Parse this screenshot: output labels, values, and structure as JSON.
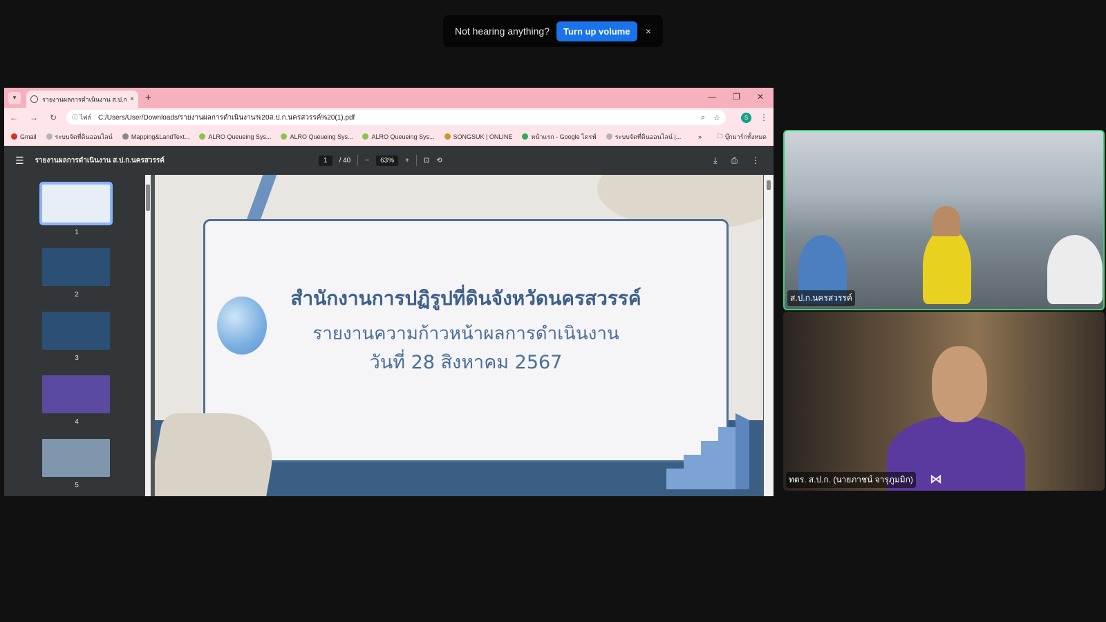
{
  "toast": {
    "message": "Not hearing anything?",
    "button": "Turn up volume",
    "close": "×"
  },
  "browser": {
    "tab_title": "รายงานผลการดำเนินงาน ส.ป.ก.นครสวรรค์",
    "tab_close": "×",
    "new_tab": "+",
    "site_info": "ไฟล์",
    "url": "C:/Users/User/Downloads/รายงานผลการดำเนินงาน%20ส.ป.ก.นครสวรรค์%20(1).pdf",
    "profile_letter": "S",
    "bookmarks": [
      {
        "label": "Gmail",
        "color": "#d93025"
      },
      {
        "label": "ระบบจัดที่ดินออนไลน์",
        "color": "#b5b5b5"
      },
      {
        "label": "Mapping&LandText...",
        "color": "#888888"
      },
      {
        "label": "ALRO Queueing Sys...",
        "color": "#8bc34a"
      },
      {
        "label": "ALRO Queueing Sys...",
        "color": "#8bc34a"
      },
      {
        "label": "ALRO Queueing Sys...",
        "color": "#8bc34a"
      },
      {
        "label": "SONGSUK | ONLINE",
        "color": "#c49a2c"
      },
      {
        "label": "หน้าแรก - Google ไดรฟ์",
        "color": "#34a853"
      },
      {
        "label": "ระบบจัดที่ดินออนไลน์ |...",
        "color": "#b5b5b5"
      }
    ],
    "bookmarks_more": "»",
    "bookmarks_folder": "บุ๊กมาร์กทั้งหมด"
  },
  "pdf": {
    "title": "รายงานผลการดำเนินงาน ส.ป.ก.นครสวรรค์",
    "page_current": "1",
    "page_total": "/ 40",
    "zoom": "63%",
    "thumbnails": [
      "1",
      "2",
      "3",
      "4",
      "5"
    ]
  },
  "slide": {
    "heading": "สำนักงานการปฏิรูปที่ดินจังหวัดนครสวรรค์",
    "subtitle": "รายงานความก้าวหน้าผลการดำเนินงาน",
    "date": "วันที่  28  สิงหาคม  2567"
  },
  "participants": [
    {
      "name": "ส.ป.ก.นครสวรรค์"
    },
    {
      "name": "ทตร. ส.ป.ก. (นายภาชน์  จารุภูมมิก)"
    }
  ],
  "colors": {
    "tab_bar": "#f7b0bd",
    "accent_blue": "#1a73e8",
    "speaker_border": "#3ad07a"
  }
}
